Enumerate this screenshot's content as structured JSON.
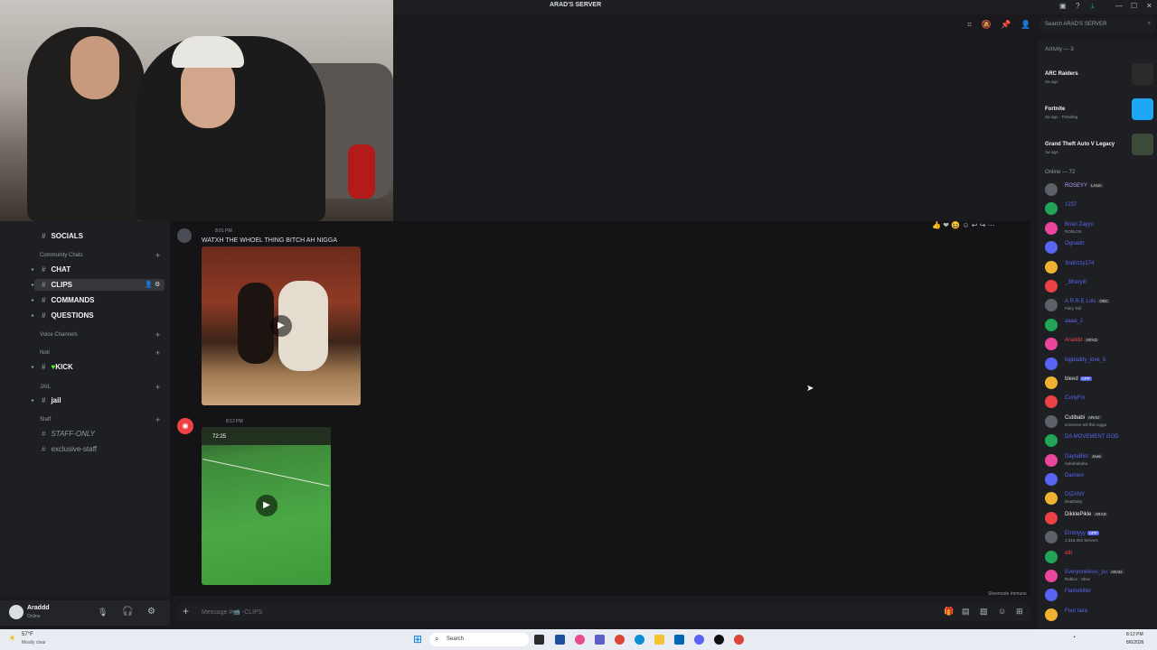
{
  "window": {
    "title": "ARAD'S SERVER",
    "controls": [
      "—",
      "☐",
      "✕"
    ]
  },
  "sidebar": {
    "socials": "SOCIALS",
    "categories": {
      "community": "Community Chats",
      "voice": "Voice Channels",
      "noti": "Noti",
      "jail": "JAIL",
      "staff": "Staff"
    },
    "channels": {
      "chat": "CHAT",
      "clips": "CLIPS",
      "commands": "COMMANDS",
      "questions": "QUESTIONS",
      "kick": "KICK",
      "jail": "jail",
      "staff_only": "STAFF-ONLY",
      "exclusive_staff": "exclusive-staff"
    }
  },
  "user": {
    "name": "Araddd",
    "status": "Online"
  },
  "messages": [
    {
      "time": "8:01 PM",
      "text": "WATXH THE WHOEL THING BITCH AH NIGGA"
    },
    {
      "time": "8:12 PM",
      "video_time": "72:25"
    }
  ],
  "composer": {
    "placeholder": "Message #📹 -CLIPS",
    "slowmode": "Slowmode Immune"
  },
  "search": {
    "placeholder": "Search ARAD'S SERVER"
  },
  "activity": {
    "header": "Activity — 3",
    "items": [
      {
        "game": "ARC Raiders",
        "meta": "2w ago",
        "color": "#2b2b2b"
      },
      {
        "game": "Fortnite",
        "meta": "2w ago · Trending",
        "color": "#1ea5f5"
      },
      {
        "game": "Grand Theft Auto V Legacy",
        "meta": "1w ago",
        "color": "#3d4a3a"
      }
    ]
  },
  "online": {
    "header": "Online — 72",
    "members": [
      {
        "name": "ROSEYY",
        "tag": "LANA",
        "color": "#b19bff"
      },
      {
        "name": "1237",
        "sub": "",
        "color": "#5865f2"
      },
      {
        "name": "Brian Zayyo",
        "sub": "ROBLOX",
        "color": "#5865f2"
      },
      {
        "name": "Ognadrt",
        "color": "#5865f2"
      },
      {
        "name": "3ndrizzy174",
        "color": "#5865f2"
      },
      {
        "name": "_3lheryi0",
        "color": "#5865f2"
      },
      {
        "name": "A.R.R.E Luis",
        "tag": "OBC",
        "sub": "Fairy Tail",
        "color": "#5865f2"
      },
      {
        "name": "aaaa_J",
        "color": "#5865f2"
      },
      {
        "name": "Araddd",
        "tag": "ARAD",
        "color": "#ed4245"
      },
      {
        "name": "bigdaddy_love_5",
        "color": "#5865f2"
      },
      {
        "name": "bleed",
        "badge": "APP",
        "color": "#dbdee1"
      },
      {
        "name": "CurlyFrx",
        "color": "#5865f2"
      },
      {
        "name": "Cutibabi",
        "tag": "ARAD",
        "sub": "someone tell this nigga",
        "color": "#f2f3f5"
      },
      {
        "name": "DA MOVEMENT GOD",
        "color": "#5865f2"
      },
      {
        "name": "DaytaBlot",
        "tag": "Jews",
        "sub": "hahahahaha",
        "color": "#5865f2"
      },
      {
        "name": "Damien",
        "color": "#5865f2"
      },
      {
        "name": "DIZANY",
        "sub": "Deathaby",
        "color": "#5865f2"
      },
      {
        "name": "DikklePikle",
        "tag": "ARAD",
        "color": "#f2f3f5"
      },
      {
        "name": "Emmyyy",
        "badge": "APP",
        "sub": "1,315,352 Servers",
        "color": "#5865f2"
      },
      {
        "name": "eth",
        "color": "#ed4245"
      },
      {
        "name": "Everyonelisvs_pu",
        "tag": "ARAD",
        "sub": "Roblox - Xbox",
        "color": "#5865f2"
      },
      {
        "name": "Flamekiller",
        "color": "#5865f2"
      },
      {
        "name": "Four lava",
        "color": "#5865f2"
      }
    ]
  },
  "taskbar": {
    "weather_temp": "57°F",
    "weather_desc": "Mostly clear",
    "search": "Search",
    "time": "8:12 PM",
    "date": "8/6/2026"
  }
}
